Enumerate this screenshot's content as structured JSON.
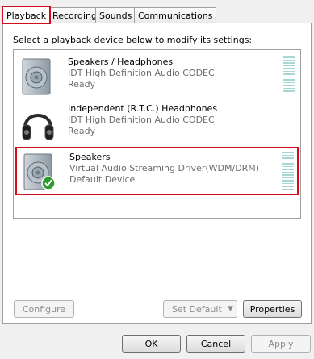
{
  "tabs": [
    {
      "label": "Playback"
    },
    {
      "label": "Recording"
    },
    {
      "label": "Sounds"
    },
    {
      "label": "Communications"
    }
  ],
  "instruction": "Select a playback device below to modify its settings:",
  "devices": [
    {
      "name": "Speakers / Headphones",
      "driver": "IDT High Definition Audio CODEC",
      "status": "Ready",
      "icon": "speaker-icon"
    },
    {
      "name": "Independent (R.T.C.) Headphones",
      "driver": "IDT High Definition Audio CODEC",
      "status": "Ready",
      "icon": "headphones-icon"
    },
    {
      "name": "Speakers",
      "driver": "Virtual Audio Streaming Driver(WDM/DRM)",
      "status": "Default Device",
      "icon": "speaker-default-icon"
    }
  ],
  "buttons": {
    "configure": "Configure",
    "set_default": "Set Default",
    "properties": "Properties",
    "ok": "OK",
    "cancel": "Cancel",
    "apply": "Apply"
  },
  "colors": {
    "highlight": "#d10d1c",
    "meter": "#a6d7d3",
    "check": "#2b9a2b"
  }
}
